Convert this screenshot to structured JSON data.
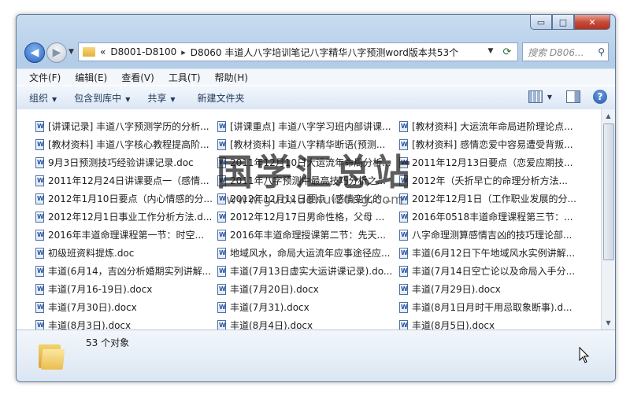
{
  "window": {
    "controls": {
      "minimize": "▭",
      "maximize": "□",
      "close": "✕"
    }
  },
  "address_bar": {
    "overflow": "«",
    "crumbs": [
      "D8001-D8100",
      "D8060 丰道人八字培训笔记八字精华八字预测word版本共53个"
    ],
    "separator": "▸",
    "search_placeholder": "搜索 D806..."
  },
  "menu": [
    "文件(F)",
    "编辑(E)",
    "查看(V)",
    "工具(T)",
    "帮助(H)"
  ],
  "toolbar": {
    "organize": "组织",
    "include_library": "包含到库中",
    "share": "共享",
    "new_folder": "新建文件夹"
  },
  "files": [
    "[讲课记录] 丰道八字预测学历的分析...",
    "[讲课重点] 丰道八字学习班内部讲课...",
    "[教材资料] 大运流年命局进阶理论点...",
    "[教材资料] 丰道八字核心教程提高阶...",
    "[教材资料] 丰道八字精华断语(预测...",
    "[教材资料] 感情恋爱中容易遭受背叛...",
    "9月3日预测技巧经验讲课记录.doc",
    "2011年12月10日大运流年命局分析...",
    "2011年12月13日要点（恋爱应期技...",
    "2011年12月24日讲课要点一（感情...",
    "2011年八字预测中最高技巧分析之...",
    "2012年（夭折早亡的命理分析方法...",
    "2012年1月10日要点（内心情感的分...",
    "2012年12月11日要点（感情变化的分...",
    "2012年12月1日（工作职业发展的分...",
    "2012年12月1日事业工作分析方法.d...",
    "2012年12月17日男命性格，父母 ...",
    "2016年0518丰道命理课程第三节：...",
    "2016年丰道命理课程第一节：时空...",
    "2016年丰道命理授课第二节：先天...",
    "八字命理测算感情吉凶的技巧理论部...",
    "初级班资料提炼.doc",
    "地域风水，命局大运流年应事途径应...",
    "丰道(6月12日下午地域风水实例讲解...",
    "丰道(6月14，吉凶分析婚期实列讲解...",
    "丰道(7月13日虚实大运讲课记录).do...",
    "丰道(7月14日空亡论以及命局入手分...",
    "丰道(7月16-19日).docx",
    "丰道(7月20日).docx",
    "丰道(7月29日).docx",
    "丰道(7月30日).docx",
    "丰道(7月31).docx",
    "丰道(8月1日月时干用忌取象断事).d...",
    "丰道(8月3日).docx",
    "丰道(8月4日).docx",
    "丰道(8月5日).docx"
  ],
  "status": {
    "count": "53 个对象"
  },
  "watermark": {
    "main": "国学汇总站",
    "url": "www.guoxuehuizong.com"
  }
}
